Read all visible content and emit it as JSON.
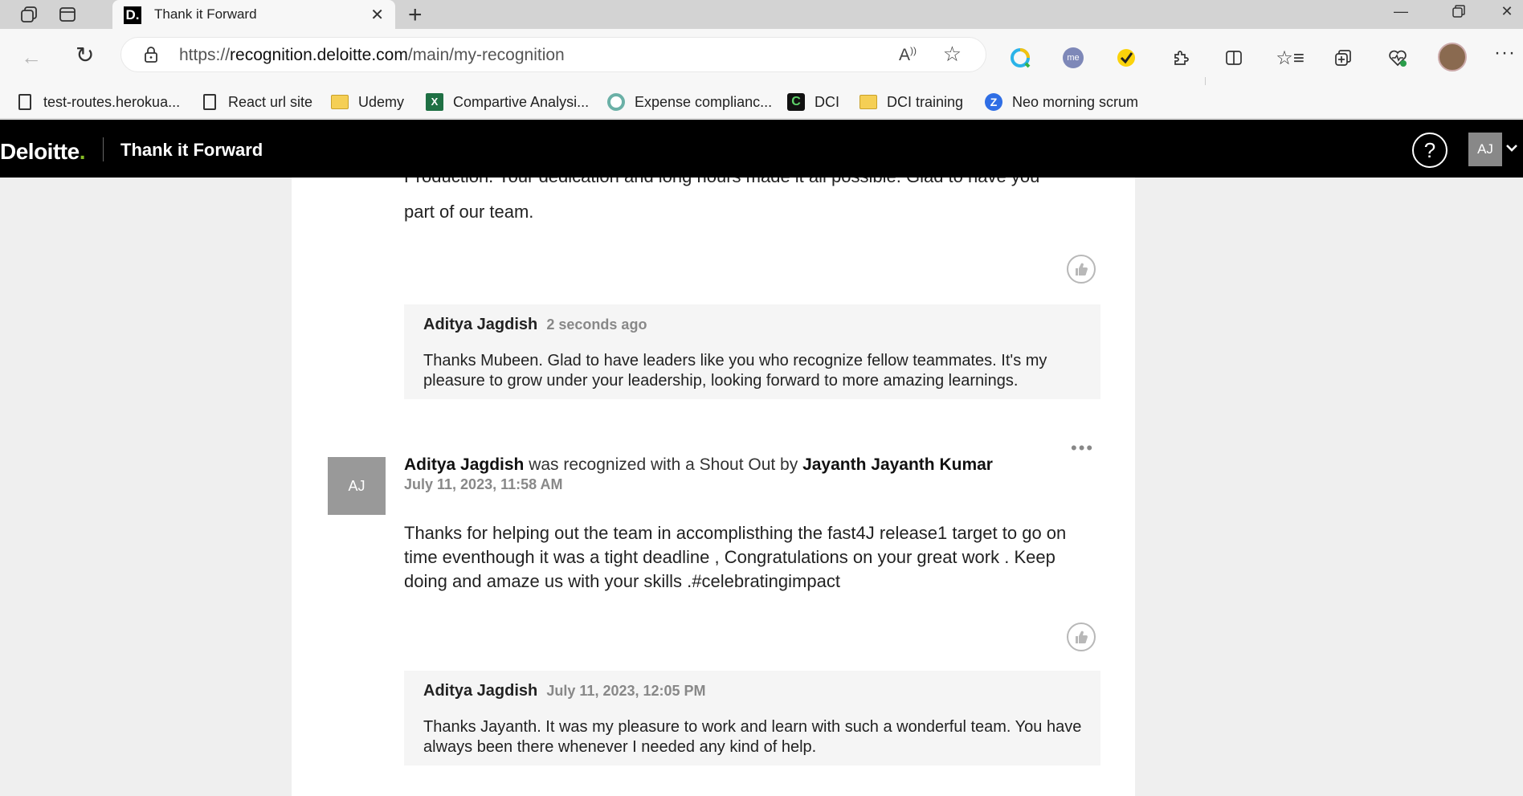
{
  "browser": {
    "tab_title": "Thank it Forward",
    "tab_favicon": "D.",
    "url_prefix": "https://",
    "url_host": "recognition.deloitte.com",
    "url_path": "/main/my-recognition",
    "read_aloud": "Aʒ",
    "bookmarks": [
      {
        "label": "test-routes.herokua...",
        "icon": "page-icon"
      },
      {
        "label": "React url site",
        "icon": "page-icon"
      },
      {
        "label": "Udemy",
        "icon": "folder-icon"
      },
      {
        "label": "Compartive Analysi...",
        "icon": "excel-icon"
      },
      {
        "label": "Expense complianc...",
        "icon": "circle-icon"
      },
      {
        "label": "DCI",
        "icon": "dci-icon"
      },
      {
        "label": "DCI training",
        "icon": "folder-icon"
      },
      {
        "label": "Neo morning scrum",
        "icon": "neo-icon"
      }
    ]
  },
  "app": {
    "brand": "Deloitte",
    "brand_dot": ".",
    "title": "Thank it Forward",
    "help": "?",
    "user_initials": "AJ",
    "accent_color": "#86bc25"
  },
  "feed": {
    "card1": {
      "message_top": "Production. Your dedication and long hours made it all possible. Glad to have you",
      "message_bottom": "part of our team.",
      "reply": {
        "author": "Aditya Jagdish",
        "time": "2 seconds ago",
        "text": "Thanks Mubeen. Glad to have leaders like you who recognize fellow teammates. It's my pleasure to grow under your leadership, looking forward to more amazing learnings."
      }
    },
    "card2": {
      "avatar": "AJ",
      "recipient": "Aditya Jagdish",
      "recognized_text": " was recognized with a Shout Out by ",
      "giver": "Jayanth Jayanth Kumar",
      "date": "July 11, 2023, 11:58 AM",
      "menu": "•••",
      "message": "Thanks for helping out the team in accomplisthing the fast4J release1 target to go on time eventhough it was a tight deadline , Congratulations on your great work . Keep doing and amaze us with your skills .#celebratingimpact",
      "reply": {
        "author": "Aditya Jagdish",
        "time": "July 11, 2023, 12:05 PM",
        "text": "Thanks Jayanth. It was my pleasure to work and learn with such a wonderful team. You have always been there whenever I needed any kind of help."
      }
    }
  }
}
